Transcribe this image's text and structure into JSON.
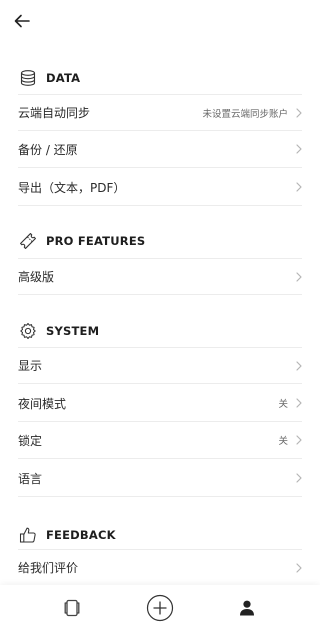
{
  "header": {
    "back_icon": "arrow-left-icon"
  },
  "sections": {
    "data": {
      "title": "DATA",
      "icon": "database-icon",
      "items": [
        {
          "label": "云端自动同步",
          "value": "未设置云端同步账户"
        },
        {
          "label": "备份 / 还原"
        },
        {
          "label": "导出（文本，PDF）"
        }
      ]
    },
    "pro": {
      "title": "PRO FEATURES",
      "icon": "ticket-icon",
      "items": [
        {
          "label": "高级版"
        }
      ]
    },
    "system": {
      "title": "SYSTEM",
      "icon": "gear-icon",
      "items": [
        {
          "label": "显示"
        },
        {
          "label": "夜间模式",
          "value": "关"
        },
        {
          "label": "锁定",
          "value": "关"
        },
        {
          "label": "语言"
        }
      ]
    },
    "feedback": {
      "title": "FEEDBACK",
      "icon": "thumbs-up-icon",
      "items": [
        {
          "label": "给我们评价"
        }
      ]
    }
  },
  "bottom_nav": {
    "items": [
      {
        "icon": "book-icon"
      },
      {
        "icon": "add-circle-icon"
      },
      {
        "icon": "person-icon"
      }
    ]
  },
  "colors": {
    "text": "#222222",
    "secondary_text": "#6a6a6a",
    "divider": "#ececec",
    "chevron": "#b5b5b5"
  }
}
